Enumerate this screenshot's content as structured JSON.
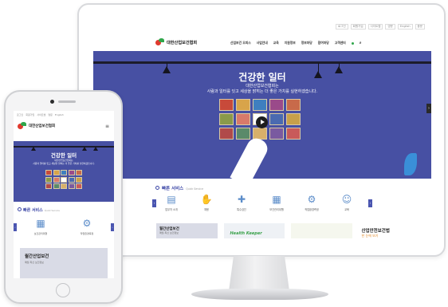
{
  "desktop": {
    "util_links": [
      "로그인",
      "회원가입",
      "사이트맵",
      "영문",
      "English",
      "중문"
    ],
    "logo_text": "대한산업보건협회",
    "nav": [
      "산업보건 오피스",
      "사업안내",
      "교육",
      "지원정보",
      "정보마당",
      "참여마당",
      "고객센터"
    ],
    "hero": {
      "title": "건강한 일터",
      "subtitle_line1": "대한산업보건협회는",
      "subtitle_line2": "사람과 일터를 잇고 세상을 밝히는 더 좋은 가치를 실현하겠습니다."
    },
    "quick_service": {
      "title": "빠른 서비스",
      "subtitle": "Quick Service",
      "items": [
        {
          "label": "업무처 소개",
          "icon": "clipboard-icon"
        },
        {
          "label": "채용",
          "icon": "handshake-icon"
        },
        {
          "label": "특수검진",
          "icon": "medical-bag-icon"
        },
        {
          "label": "보건관리대행",
          "icon": "building-icon"
        },
        {
          "label": "작업환경측정",
          "icon": "settings-icon"
        },
        {
          "label": "교육",
          "icon": "person-icon"
        }
      ]
    },
    "cards": {
      "magazine_title": "월간산업보건",
      "magazine_sub": "매월 최신 보건정보",
      "health_keeper": "Health Keeper",
      "law_title": "산업안전보건법",
      "law_sub": "한 눈에 보기"
    }
  },
  "mobile": {
    "util_links": [
      "로그인",
      "회원가입",
      "사이트맵",
      "영문",
      "English"
    ],
    "logo_text": "대한산업보건협회",
    "hero": {
      "title": "건강한 일터",
      "subtitle_line1": "대한산업보건협회는",
      "subtitle_line2": "사람과 일터를 잇고 세상을 밝히는 더 좋은 가치를 실현하겠습니다."
    },
    "quick_service": {
      "title": "빠른 서비스",
      "subtitle": "Quick Service",
      "items": [
        {
          "label": "보건관리대행",
          "icon": "building-icon"
        },
        {
          "label": "작업환경측정",
          "icon": "settings-icon"
        }
      ]
    },
    "card": {
      "title": "월간산업보건",
      "sub": "매월 최신 보건정보"
    }
  },
  "colors": {
    "hero_bg": "#4750a3",
    "accent": "#3b46a6",
    "logo_red": "#e03a2e",
    "logo_green": "#2fa64a"
  }
}
